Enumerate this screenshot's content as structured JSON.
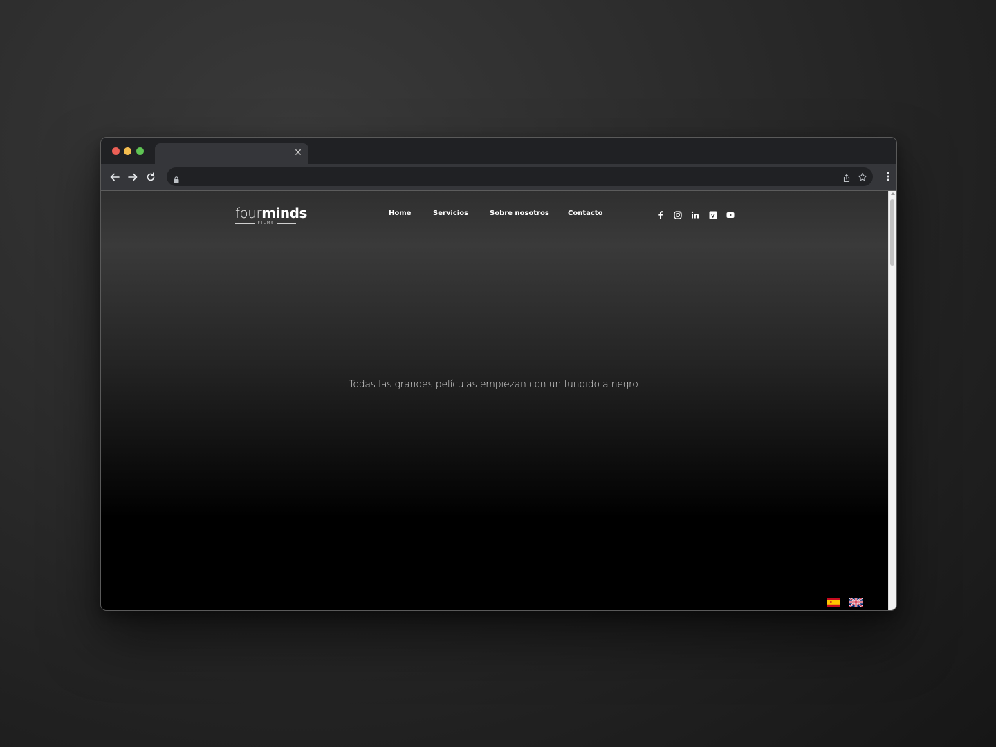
{
  "browser": {
    "tab": {
      "title": "",
      "close_icon": "close-icon"
    },
    "address_bar": {
      "url": "",
      "placeholder": ""
    },
    "toolbar_icons": [
      "back-arrow-icon",
      "forward-arrow-icon",
      "reload-icon",
      "lock-icon",
      "share-icon",
      "star-icon",
      "kebab-menu-icon"
    ]
  },
  "site": {
    "logo": {
      "word_light": "four",
      "word_bold": "minds",
      "subtitle": "FILMS"
    },
    "nav": [
      {
        "label": "Home"
      },
      {
        "label": "Servicios"
      },
      {
        "label": "Sobre nosotros"
      },
      {
        "label": "Contacto"
      }
    ],
    "social_icons": [
      "facebook-icon",
      "instagram-icon",
      "linkedin-icon",
      "vimeo-icon",
      "youtube-icon"
    ],
    "tagline": "Todas las grandes películas empiezan con un fundido a negro.",
    "languages": [
      "spanish-flag",
      "uk-flag"
    ]
  },
  "colors": {
    "page_gradient_top": "#3a3a3a",
    "page_bottom": "#000000",
    "text_primary": "#ffffff",
    "traffic_red": "#ec5f56",
    "traffic_yellow": "#f4bd4f",
    "traffic_green": "#5fc454"
  }
}
